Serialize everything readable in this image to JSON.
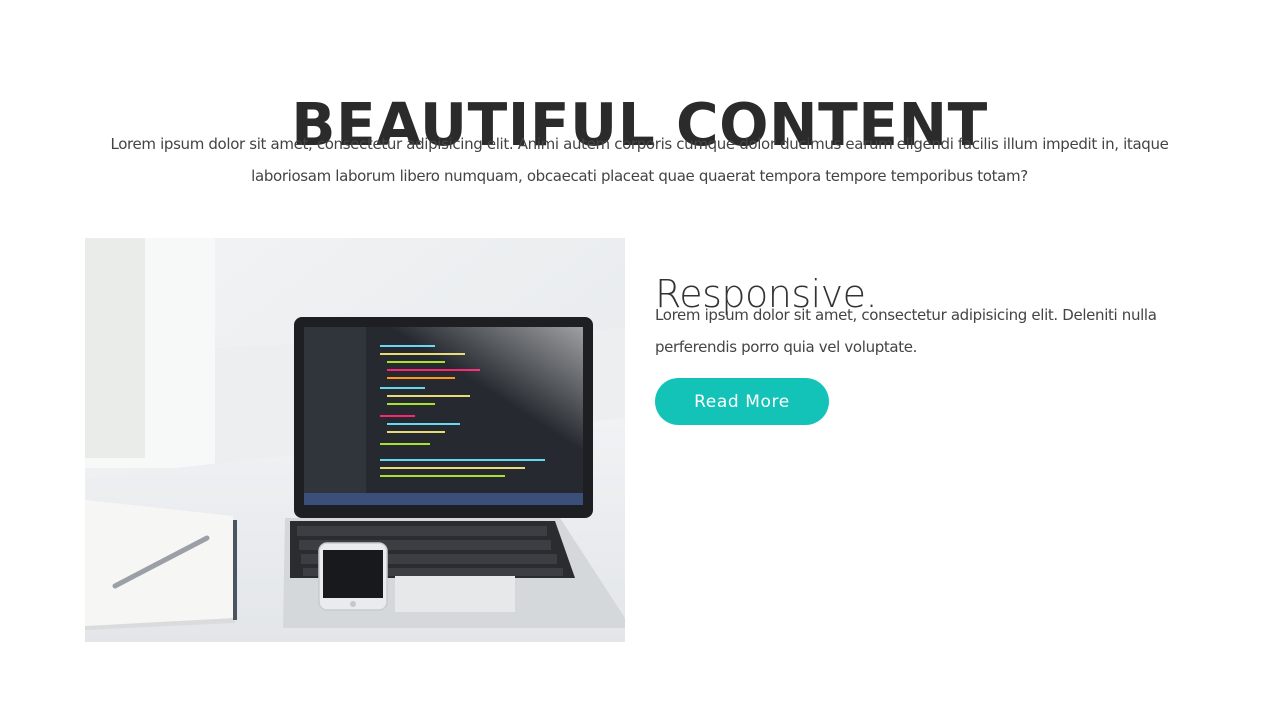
{
  "section": {
    "title": "BEAUTIFUL CONTENT",
    "intro_line1": "Lorem ipsum dolor sit amet, consectetur adipisicing elit. Animi autem corporis cumque dolor ducimus earum eligendi facilis illum impedit in, itaque",
    "intro_line2": "laboriosam laborum libero numquam, obcaecati placeat quae quaerat tempora tempore temporibus totam?"
  },
  "feature": {
    "title": "Responsive.",
    "text_line1": "Lorem ipsum dolor sit amet, consectetur adipisicing elit. Deleniti nulla",
    "text_line2": "perferendis porro quia vel voluptate.",
    "button_label": "Read More"
  },
  "colors": {
    "accent": "#14c3b7",
    "heading": "#2b2b2b",
    "body_text": "#444444"
  }
}
